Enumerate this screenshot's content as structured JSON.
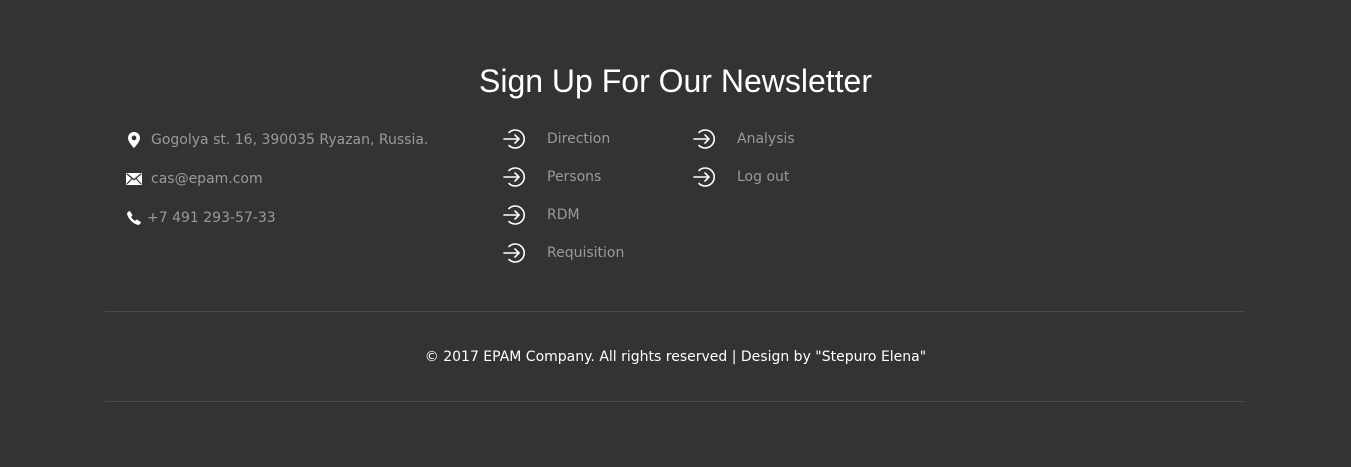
{
  "newsletter": {
    "title": "Sign Up For Our Newsletter"
  },
  "contacts": {
    "address": "Gogolya st. 16, 390035 Ryazan, Russia.",
    "email": "cas@epam.com",
    "phone": "+7 491 293-57-33"
  },
  "nav": {
    "col1": [
      {
        "label": "Direction",
        "icon": "sign-in-icon"
      },
      {
        "label": "Persons",
        "icon": "sign-in-icon"
      },
      {
        "label": "RDM",
        "icon": "sign-in-icon"
      },
      {
        "label": "Requisition",
        "icon": "sign-in-icon"
      }
    ],
    "col2": [
      {
        "label": "Analysis",
        "icon": "sign-in-icon"
      },
      {
        "label": "Log out",
        "icon": "sign-in-icon"
      }
    ]
  },
  "footer": {
    "copyright": "© 2017 EPAM Company. All rights reserved | Design by \"Stepuro Elena\""
  },
  "colors": {
    "background": "#333333",
    "text_muted": "#9a9a9a",
    "text_light": "#ffffff",
    "divider": "#4a4a4a"
  }
}
